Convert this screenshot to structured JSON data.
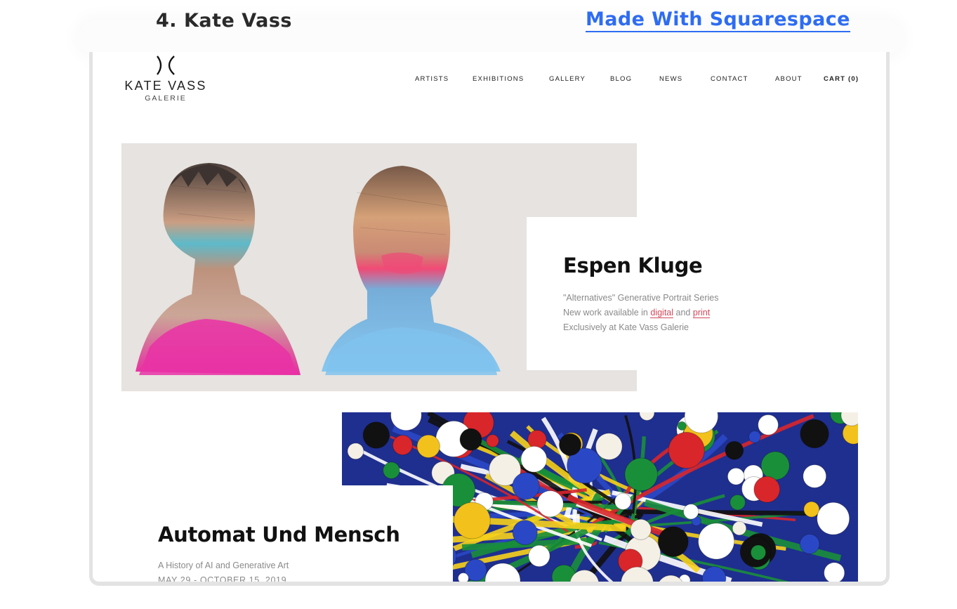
{
  "heading": {
    "number_title": "4. Kate Vass",
    "link": "Made With Squarespace"
  },
  "logo": {
    "name": "KATE VASS",
    "subtitle": "GALERIE"
  },
  "nav": {
    "items": [
      "ARTISTS",
      "EXHIBITIONS",
      "GALLERY",
      "BLOG",
      "NEWS",
      "CONTACT",
      "ABOUT"
    ],
    "cart": "CART (0)"
  },
  "feature1": {
    "title": "Espen Kluge",
    "line1": "\"Alternatives\" Generative Portrait Series",
    "line2_prefix": "New work available in",
    "link_digital": "digital",
    "line2_and": "and",
    "link_print": "print",
    "line3": "Exclusively at Kate Vass Galerie"
  },
  "feature2": {
    "title": "Automat Und Mensch",
    "subtitle": "A History of AI and Generative Art",
    "dates": "MAY 29 - OCTOBER 15, 2019"
  },
  "colors": {
    "link_blue": "#2e6cf2",
    "accent_link": "#d0485a",
    "hero_bg": "#e6e3e0",
    "text_muted": "#8a8a8a"
  }
}
